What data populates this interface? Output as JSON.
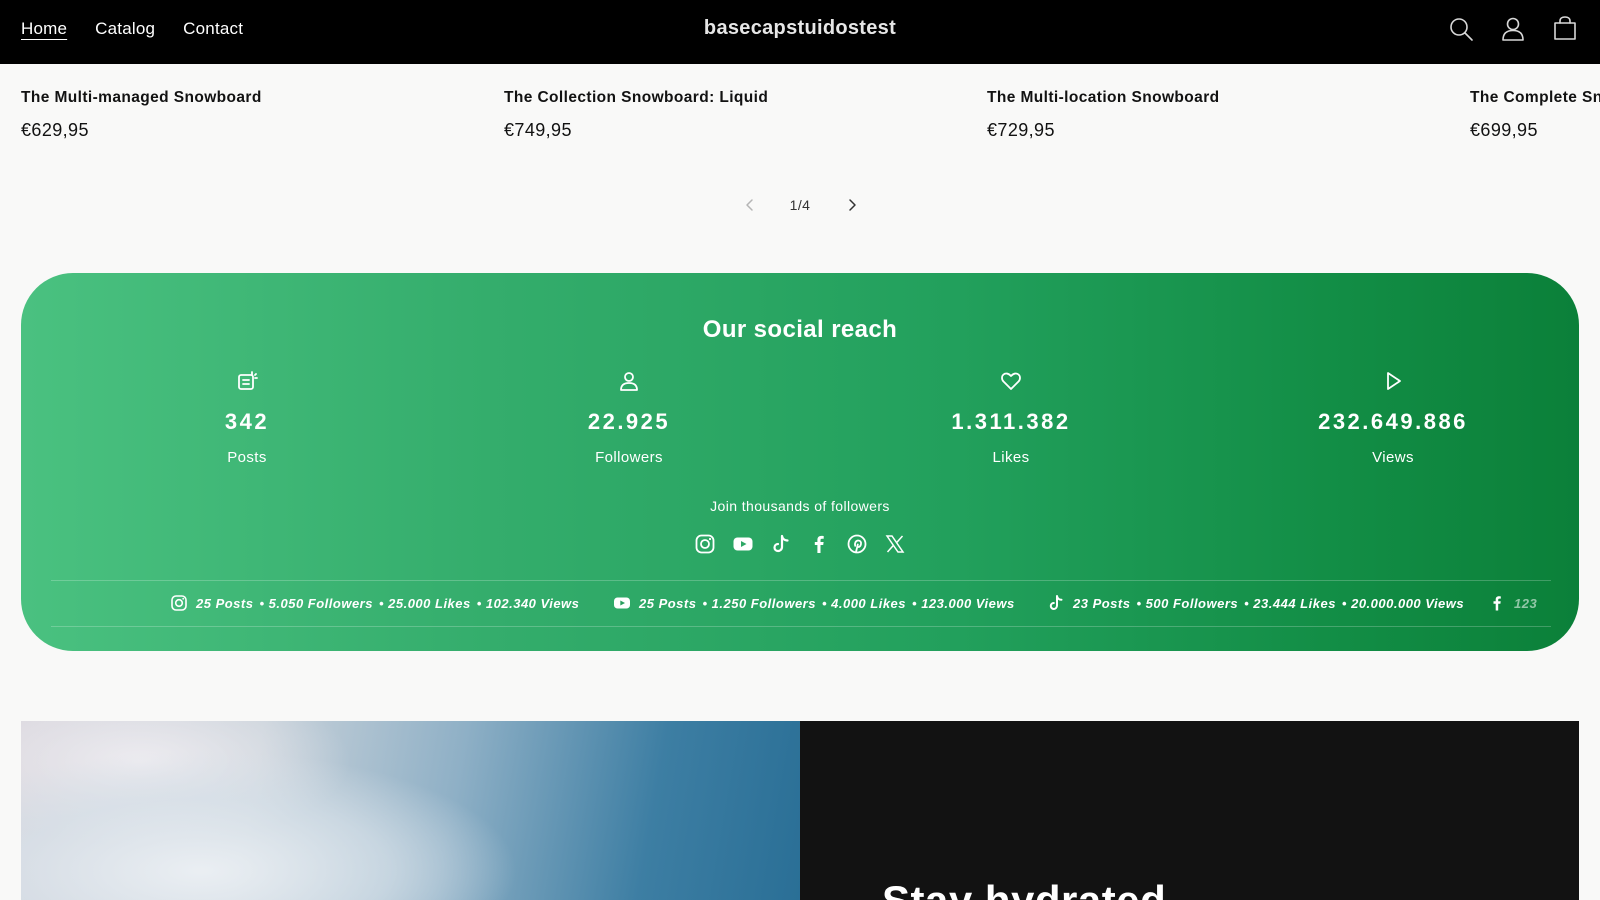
{
  "header": {
    "nav": [
      {
        "label": "Home",
        "active": true
      },
      {
        "label": "Catalog",
        "active": false
      },
      {
        "label": "Contact",
        "active": false
      }
    ],
    "brand": "basecapstuidostest",
    "icons": [
      "search-icon",
      "account-icon",
      "cart-icon"
    ]
  },
  "products": [
    {
      "name": "The Multi-managed Snowboard",
      "price": "€629,95"
    },
    {
      "name": "The Collection Snowboard: Liquid",
      "price": "€749,95"
    },
    {
      "name": "The Multi-location Snowboard",
      "price": "€729,95"
    },
    {
      "name": "The Complete Sn",
      "price": "€699,95"
    }
  ],
  "pagination": {
    "counter": "1/4"
  },
  "social": {
    "title": "Our social reach",
    "stats": [
      {
        "icon": "posts-icon",
        "value": "342",
        "label": "Posts"
      },
      {
        "icon": "user-icon",
        "value": "22.925",
        "label": "Followers"
      },
      {
        "icon": "heart-icon",
        "value": "1.311.382",
        "label": "Likes"
      },
      {
        "icon": "play-icon",
        "value": "232.649.886",
        "label": "Views"
      }
    ],
    "join_text": "Join thousands of followers",
    "platform_icons": [
      "instagram-icon",
      "youtube-icon",
      "tiktok-icon",
      "facebook-icon",
      "pinterest-icon",
      "x-icon"
    ],
    "ticker": [
      {
        "icon": "instagram-icon",
        "posts": "25 Posts",
        "followers": "• 5.050 Followers",
        "likes": "• 25.000 Likes",
        "views": "• 102.340 Views"
      },
      {
        "icon": "youtube-icon",
        "posts": "25 Posts",
        "followers": "• 1.250 Followers",
        "likes": "• 4.000 Likes",
        "views": "• 123.000 Views"
      },
      {
        "icon": "tiktok-icon",
        "posts": "23 Posts",
        "followers": "• 500 Followers",
        "likes": "• 23.444 Likes",
        "views": "• 20.000.000 Views"
      },
      {
        "icon": "facebook-icon",
        "posts": "123"
      }
    ],
    "colors": {
      "gradient_start": "#4ac180",
      "gradient_end": "#0b8039"
    }
  },
  "banner": {
    "headline": "Stay hydrated"
  }
}
